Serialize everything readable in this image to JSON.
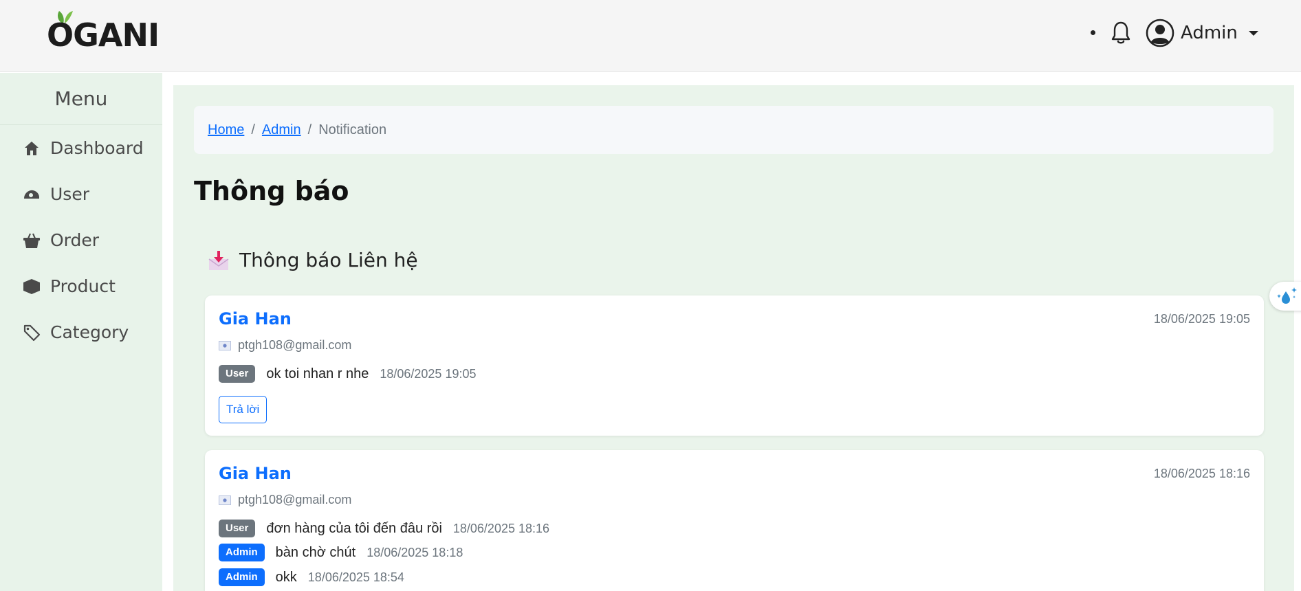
{
  "header": {
    "logo_text": "OGANI",
    "user_name": "Admin"
  },
  "sidebar": {
    "title": "Menu",
    "items": [
      {
        "label": "Dashboard",
        "icon": "home-icon"
      },
      {
        "label": "User",
        "icon": "user-icon"
      },
      {
        "label": "Order",
        "icon": "basket-icon"
      },
      {
        "label": "Product",
        "icon": "box-icon"
      },
      {
        "label": "Category",
        "icon": "tag-icon"
      }
    ]
  },
  "breadcrumb": {
    "home": "Home",
    "admin": "Admin",
    "current": "Notification",
    "separator": "/"
  },
  "page_title": "Thông báo",
  "section_title": "Thông báo Liên hệ",
  "cards": [
    {
      "name": "Gia Han",
      "time": "18/06/2025 19:05",
      "email": "ptgh108@gmail.com",
      "messages": [
        {
          "role": "User",
          "text": "ok toi nhan r nhe",
          "time": "18/06/2025 19:05"
        }
      ],
      "reply_label": "Trả lời"
    },
    {
      "name": "Gia Han",
      "time": "18/06/2025 18:16",
      "email": "ptgh108@gmail.com",
      "messages": [
        {
          "role": "User",
          "text": "đơn hàng của tôi đến đâu rồi",
          "time": "18/06/2025 18:16"
        },
        {
          "role": "Admin",
          "text": "bàn chờ chút",
          "time": "18/06/2025 18:18"
        },
        {
          "role": "Admin",
          "text": "okk",
          "time": "18/06/2025 18:54"
        }
      ]
    }
  ],
  "colors": {
    "primary": "#0d6efd",
    "user_badge": "#6c757d",
    "sidebar_bg": "#e8f3ea",
    "main_bg": "#eaf4eb"
  }
}
